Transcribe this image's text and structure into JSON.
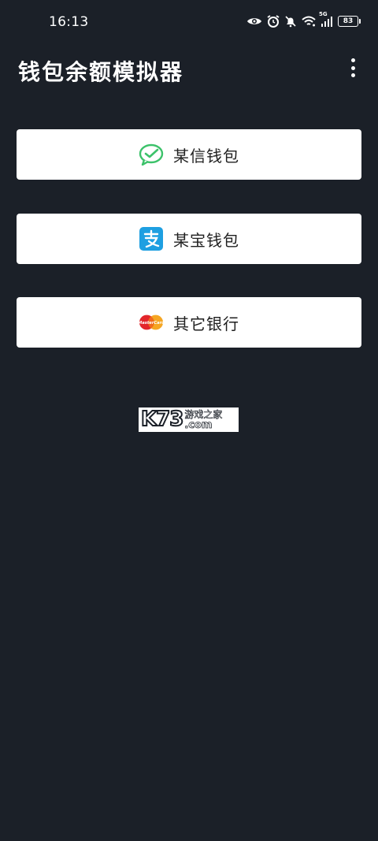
{
  "status_bar": {
    "time": "16:13",
    "network": "5G",
    "battery": "83",
    "icons": [
      "eye-icon",
      "alarm-icon",
      "mute-icon",
      "wifi-icon",
      "signal-icon",
      "battery-icon"
    ]
  },
  "app_bar": {
    "title": "钱包余额模拟器",
    "menu_icon": "more-vert-icon"
  },
  "buttons": [
    {
      "label": "某信钱包",
      "icon": "wechat-icon",
      "color": "#3cc26a"
    },
    {
      "label": "某宝钱包",
      "icon": "alipay-icon",
      "color": "#1e9fe1"
    },
    {
      "label": "其它银行",
      "icon": "mastercard-icon",
      "colors": [
        "#e3262b",
        "#f5a623"
      ],
      "icon_text": "MasterCard"
    }
  ],
  "watermark": {
    "brand": "K73",
    "cn": "游戏之家",
    "domain": ".com"
  },
  "colors": {
    "background": "#1b2028",
    "button_bg": "#ffffff",
    "button_text": "#1f1f1f"
  }
}
